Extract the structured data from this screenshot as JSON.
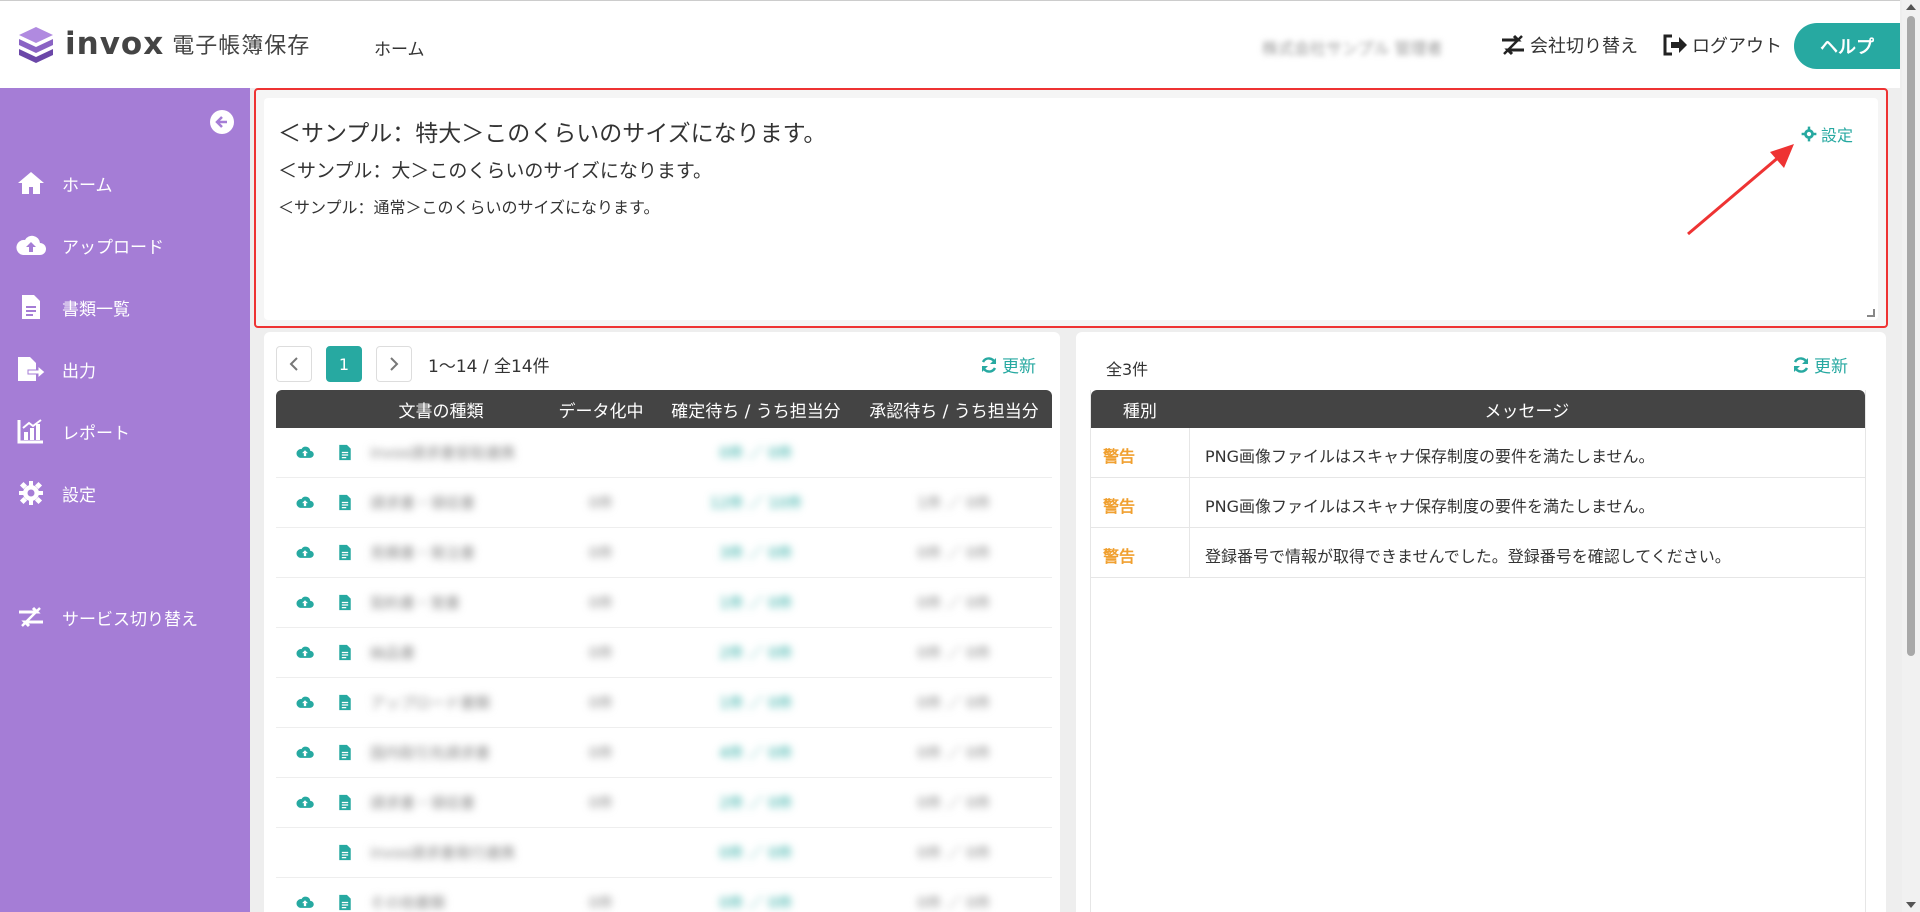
{
  "header": {
    "logo_text": "invox",
    "logo_sub": "電子帳簿保存",
    "nav_home": "ホーム",
    "company_name": "株式会社サンプル 管理者",
    "switch_company": "会社切り替え",
    "logout": "ログアウト",
    "help": "ヘルプ"
  },
  "sidebar": {
    "items": [
      {
        "label": "ホーム",
        "icon": "home-icon"
      },
      {
        "label": "アップロード",
        "icon": "cloud-upload-icon"
      },
      {
        "label": "書類一覧",
        "icon": "document-icon"
      },
      {
        "label": "出力",
        "icon": "export-icon"
      },
      {
        "label": "レポート",
        "icon": "chart-icon"
      },
      {
        "label": "設定",
        "icon": "gear-icon"
      },
      {
        "label": "サービス切り替え",
        "icon": "switch-icon"
      }
    ]
  },
  "sample": {
    "xl": "＜サンプル：特大＞このくらいのサイズになります。",
    "l": "＜サンプル：大＞このくらいのサイズになります。",
    "normal": "＜サンプル：通常＞このくらいのサイズになります。",
    "settings": "設定"
  },
  "left_panel": {
    "page": "1",
    "range": "1〜14 / 全14件",
    "refresh": "更新",
    "columns": [
      "文書の種類",
      "データ化中",
      "確定待ち / うち担当分",
      "承認待ち / うち担当分"
    ],
    "rows": [
      {
        "name": "invox請求書受取連携",
        "processing": "",
        "confirm": "0件 ／ 0件",
        "approve": "",
        "upload": true
      },
      {
        "name": "請求書・領収書",
        "processing": "0件",
        "confirm": "12件 ／ 10件",
        "approve": "1件 ／ 0件",
        "upload": true
      },
      {
        "name": "見積書・発注書",
        "processing": "0件",
        "confirm": "3件 ／ 0件",
        "approve": "0件 ／ 0件",
        "upload": true
      },
      {
        "name": "契約書・覚書",
        "processing": "0件",
        "confirm": "1件 ／ 0件",
        "approve": "0件 ／ 0件",
        "upload": true
      },
      {
        "name": "納品書",
        "processing": "0件",
        "confirm": "2件 ／ 0件",
        "approve": "0件 ／ 0件",
        "upload": true
      },
      {
        "name": "アップロード書類",
        "processing": "0件",
        "confirm": "1件 ／ 0件",
        "approve": "0件 ／ 0件",
        "upload": true
      },
      {
        "name": "国内取引先請求書",
        "processing": "0件",
        "confirm": "4件 ／ 0件",
        "approve": "0件 ／ 0件",
        "upload": true
      },
      {
        "name": "請求書・領収書",
        "processing": "0件",
        "confirm": "2件 ／ 0件",
        "approve": "0件 ／ 0件",
        "upload": true
      },
      {
        "name": "invox請求書発行連携",
        "processing": "",
        "confirm": "0件 ／ 0件",
        "approve": "0件 ／ 0件",
        "upload": false
      },
      {
        "name": "その他書類",
        "processing": "0件",
        "confirm": "0件 ／ 0件",
        "approve": "0件 ／ 0件",
        "upload": true
      }
    ]
  },
  "right_panel": {
    "count": "全3件",
    "refresh": "更新",
    "col_type": "種別",
    "col_message": "メッセージ",
    "rows": [
      {
        "type": "警告",
        "message": "PNG画像ファイルはスキャナ保存制度の要件を満たしません。"
      },
      {
        "type": "警告",
        "message": "PNG画像ファイルはスキャナ保存制度の要件を満たしません。"
      },
      {
        "type": "警告",
        "message": "登録番号で情報が取得できませんでした。登録番号を確認してください。"
      }
    ]
  }
}
